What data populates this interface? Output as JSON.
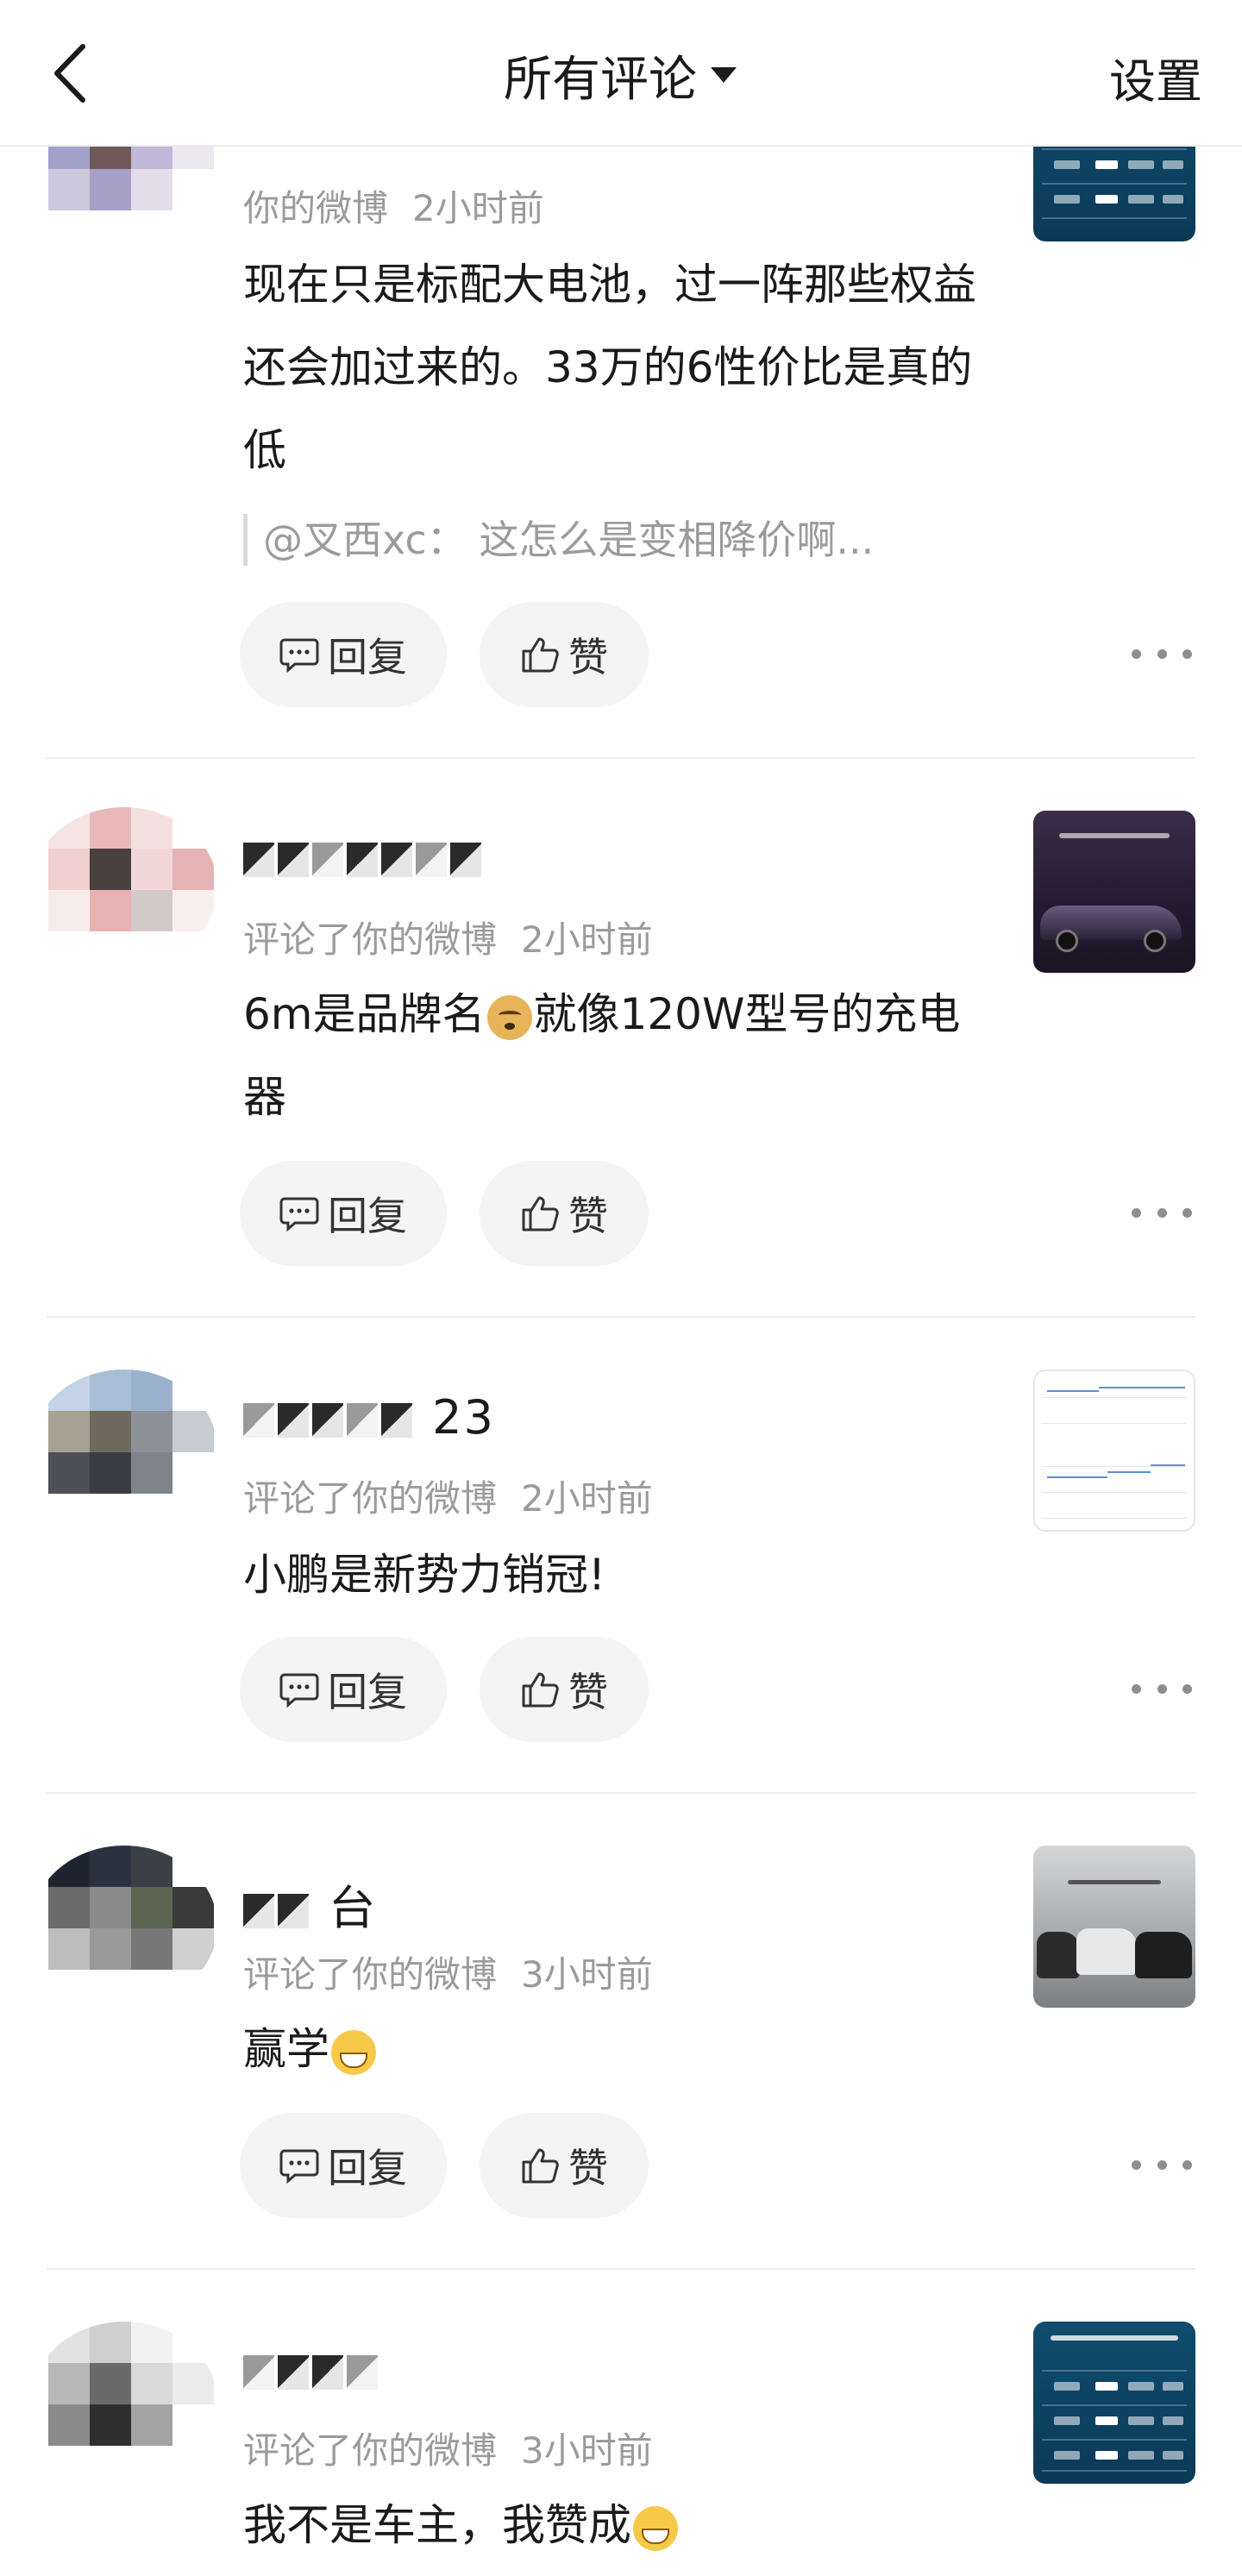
{
  "header": {
    "title": "所有评论",
    "settings_label": "设置"
  },
  "actions": {
    "reply_label": "回复",
    "like_label": "赞"
  },
  "comments": [
    {
      "name": "",
      "meta_prefix": "你的微博",
      "time": "2小时前",
      "text": "现在只是标配大电池，过一阵那些权益还会加过来的。33万的6性价比是真的低",
      "quote": "@叉西xc：  这怎么是变相降价啊...",
      "thumbnail": "battery-table-image"
    },
    {
      "name": "",
      "meta_prefix": "评论了你的微博",
      "time": "2小时前",
      "text_a": "6m是品牌名",
      "text_b": "就像120W型号的充电器",
      "thumbnail": "car-photo-image"
    },
    {
      "name": "23",
      "meta_prefix": "评论了你的微博",
      "time": "2小时前",
      "text": "小鹏是新势力销冠!",
      "thumbnail": "line-chart-image"
    },
    {
      "name": "台",
      "meta_prefix": "评论了你的微博",
      "time": "3小时前",
      "text": "赢学",
      "thumbnail": "suv-lineup-image"
    },
    {
      "name": "",
      "meta_prefix": "评论了你的微博",
      "time": "3小时前",
      "text": "我不是车主，我赞成",
      "thumbnail": "battery-table-image"
    }
  ],
  "colors": {
    "text_primary": "#1a1a1a",
    "text_secondary": "#9b9b9b",
    "button_bg": "#f4f4f4",
    "divider": "#eeeeee"
  }
}
